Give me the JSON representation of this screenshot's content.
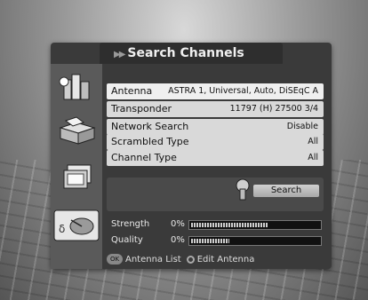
{
  "window": {
    "title": "Search Channels"
  },
  "settings": [
    {
      "label": "Antenna",
      "value": "ASTRA 1, Universal, Auto, DiSEqC A"
    },
    {
      "label": "Transponder",
      "value": "11797 (H) 27500 3/4"
    },
    {
      "label": "Network Search",
      "value": "Disable"
    },
    {
      "label": "Scrambled Type",
      "value": "All"
    },
    {
      "label": "Channel Type",
      "value": "All"
    }
  ],
  "search": {
    "label": "Search"
  },
  "meters": [
    {
      "label": "Strength",
      "percent": "0%",
      "level": 0.6
    },
    {
      "label": "Quality",
      "percent": "0%",
      "level": 0.3
    }
  ],
  "footer": {
    "ok_key": "OK",
    "antenna_list": "Antenna List",
    "edit_antenna": "Edit Antenna"
  },
  "colors": {
    "panel": "#3a3a3a",
    "row": "#d9d9d9",
    "selected_row": "#efefef"
  }
}
